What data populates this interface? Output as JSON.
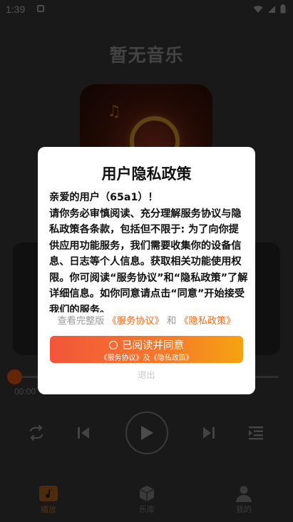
{
  "status_bar": {
    "time": "1:39"
  },
  "app": {
    "title": "暂无音乐",
    "progress_fraction": 0.0,
    "current_time": "00:00"
  },
  "tabs": [
    {
      "label": "播放",
      "icon": "music-note-icon",
      "active": true
    },
    {
      "label": "乐库",
      "icon": "cube-icon",
      "active": false
    },
    {
      "label": "我的",
      "icon": "person-icon",
      "active": false
    }
  ],
  "dialog": {
    "title": "用户隐私政策",
    "greeting": "亲爱的用户（65a1）！",
    "body": "请你务必审慎阅读、充分理解服务协议与隐私政策各条款，包括但不限于: 为了向你提供应用功能服务，我们需要收集你的设备信息、日志等个人信息。获取相关功能使用权限。你可阅读“服务协议”和“隐私政策”了解详细信息。如你同意请点击“同意”开始接受我们的服务。",
    "links": {
      "prefix": "查看完整版",
      "service": "《服务协议》",
      "conjunction": "和",
      "privacy": "《隐私政策》"
    },
    "agree": {
      "label": "已阅读并同意",
      "sublabel": "《服务协议》及《隐私政策》"
    },
    "exit_label": "退出"
  },
  "colors": {
    "accent": "#f26b1d",
    "gradient_start": "#f2553a",
    "gradient_end": "#f5a311",
    "background": "#2e2e2e"
  }
}
